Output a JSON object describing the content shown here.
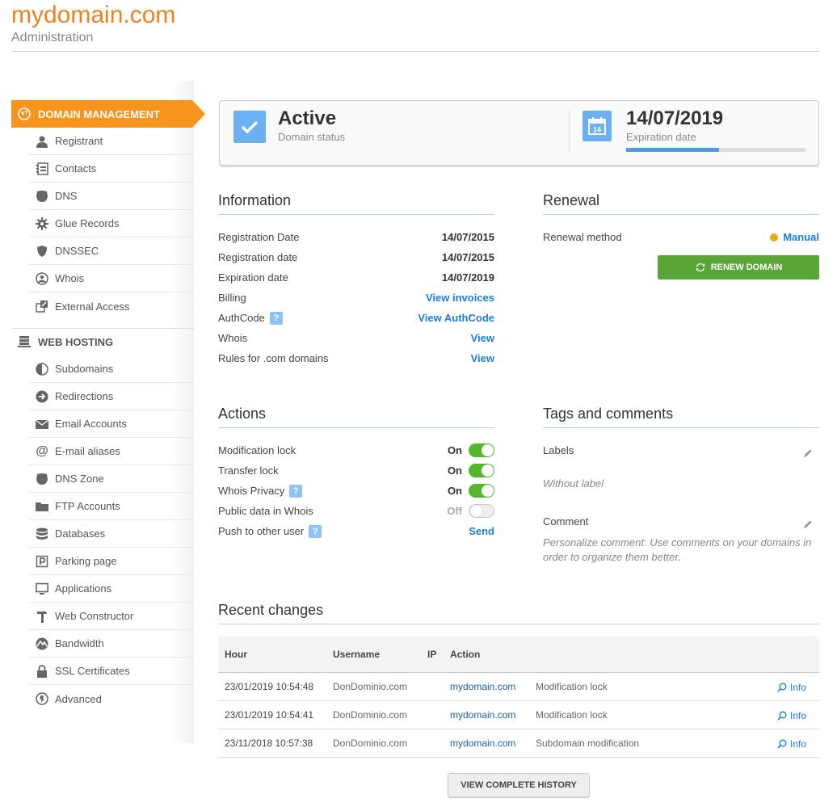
{
  "header": {
    "title": "mydomain.com",
    "subtitle": "Administration"
  },
  "sidebar": {
    "domain_section": "DOMAIN MANAGEMENT",
    "domain_items": [
      {
        "label": "Registrant",
        "icon": "user-icon"
      },
      {
        "label": "Contacts",
        "icon": "contacts-icon"
      },
      {
        "label": "DNS",
        "icon": "dns-icon"
      },
      {
        "label": "Glue Records",
        "icon": "gear-icon"
      },
      {
        "label": "DNSSEC",
        "icon": "shield-icon"
      },
      {
        "label": "Whois",
        "icon": "whois-icon"
      },
      {
        "label": "External Access",
        "icon": "external-icon"
      }
    ],
    "hosting_section": "WEB HOSTING",
    "hosting_items": [
      {
        "label": "Subdomains",
        "icon": "half-circle-icon"
      },
      {
        "label": "Redirections",
        "icon": "redirect-icon"
      },
      {
        "label": "Email Accounts",
        "icon": "envelope-icon"
      },
      {
        "label": "E-mail aliases",
        "icon": "at-icon"
      },
      {
        "label": "DNS Zone",
        "icon": "dns-icon"
      },
      {
        "label": "FTP Accounts",
        "icon": "folder-icon"
      },
      {
        "label": "Databases",
        "icon": "database-icon"
      },
      {
        "label": "Parking page",
        "icon": "parking-icon"
      },
      {
        "label": "Applications",
        "icon": "monitor-icon"
      },
      {
        "label": "Web Constructor",
        "icon": "hammer-icon"
      },
      {
        "label": "Bandwidth",
        "icon": "bandwidth-icon"
      },
      {
        "label": "SSL Certificates",
        "icon": "lock-icon"
      },
      {
        "label": "Advanced",
        "icon": "advanced-icon"
      }
    ]
  },
  "status": {
    "state": "Active",
    "state_label": "Domain status",
    "calendar_day": "14",
    "expiration": "14/07/2019",
    "expiration_label": "Expiration date",
    "progress": 0.52
  },
  "information": {
    "title": "Information",
    "rows": [
      {
        "label": "Registration Date",
        "value": "14/07/2015"
      },
      {
        "label": "Registration date",
        "value": "14/07/2015"
      },
      {
        "label": "Expiration date",
        "value": "14/07/2019"
      },
      {
        "label": "Billing",
        "link": "View invoices"
      },
      {
        "label": "AuthCode",
        "link": "View AuthCode",
        "help": "?"
      },
      {
        "label": "Whois",
        "link": "View"
      },
      {
        "label": "Rules for .com domains",
        "link": "View"
      }
    ]
  },
  "renewal": {
    "title": "Renewal",
    "method_label": "Renewal method",
    "method_value": "Manual",
    "button": "RENEW DOMAIN"
  },
  "actions": {
    "title": "Actions",
    "rows": [
      {
        "label": "Modification lock",
        "state": "On"
      },
      {
        "label": "Transfer lock",
        "state": "On"
      },
      {
        "label": "Whois Privacy",
        "state": "On",
        "help": "?"
      },
      {
        "label": "Public data in Whois",
        "state": "Off"
      },
      {
        "label": "Push to other user",
        "link": "Send",
        "help": "?"
      }
    ]
  },
  "tags": {
    "title": "Tags and comments",
    "labels_label": "Labels",
    "labels_empty": "Without label",
    "comment_label": "Comment",
    "comment_placeholder": "Personalize comment: Use comments on your domains in order to organize them better."
  },
  "recent": {
    "title": "Recent changes",
    "columns": {
      "hour": "Hour",
      "username": "Username",
      "ip": "IP",
      "action": "Action"
    },
    "rows": [
      {
        "hour": "23/01/2019 10:54:48",
        "user": "DonDominio.com",
        "domain": "mydomain.com",
        "action": "Modification lock",
        "info": "Info"
      },
      {
        "hour": "23/01/2019 10:54:41",
        "user": "DonDominio.com",
        "domain": "mydomain.com",
        "action": "Modification lock",
        "info": "Info"
      },
      {
        "hour": "23/11/2018 10:57:38",
        "user": "DonDominio.com",
        "domain": "mydomain.com",
        "action": "Subdomain modification",
        "info": "Info"
      }
    ],
    "history_button": "VIEW COMPLETE HISTORY"
  }
}
